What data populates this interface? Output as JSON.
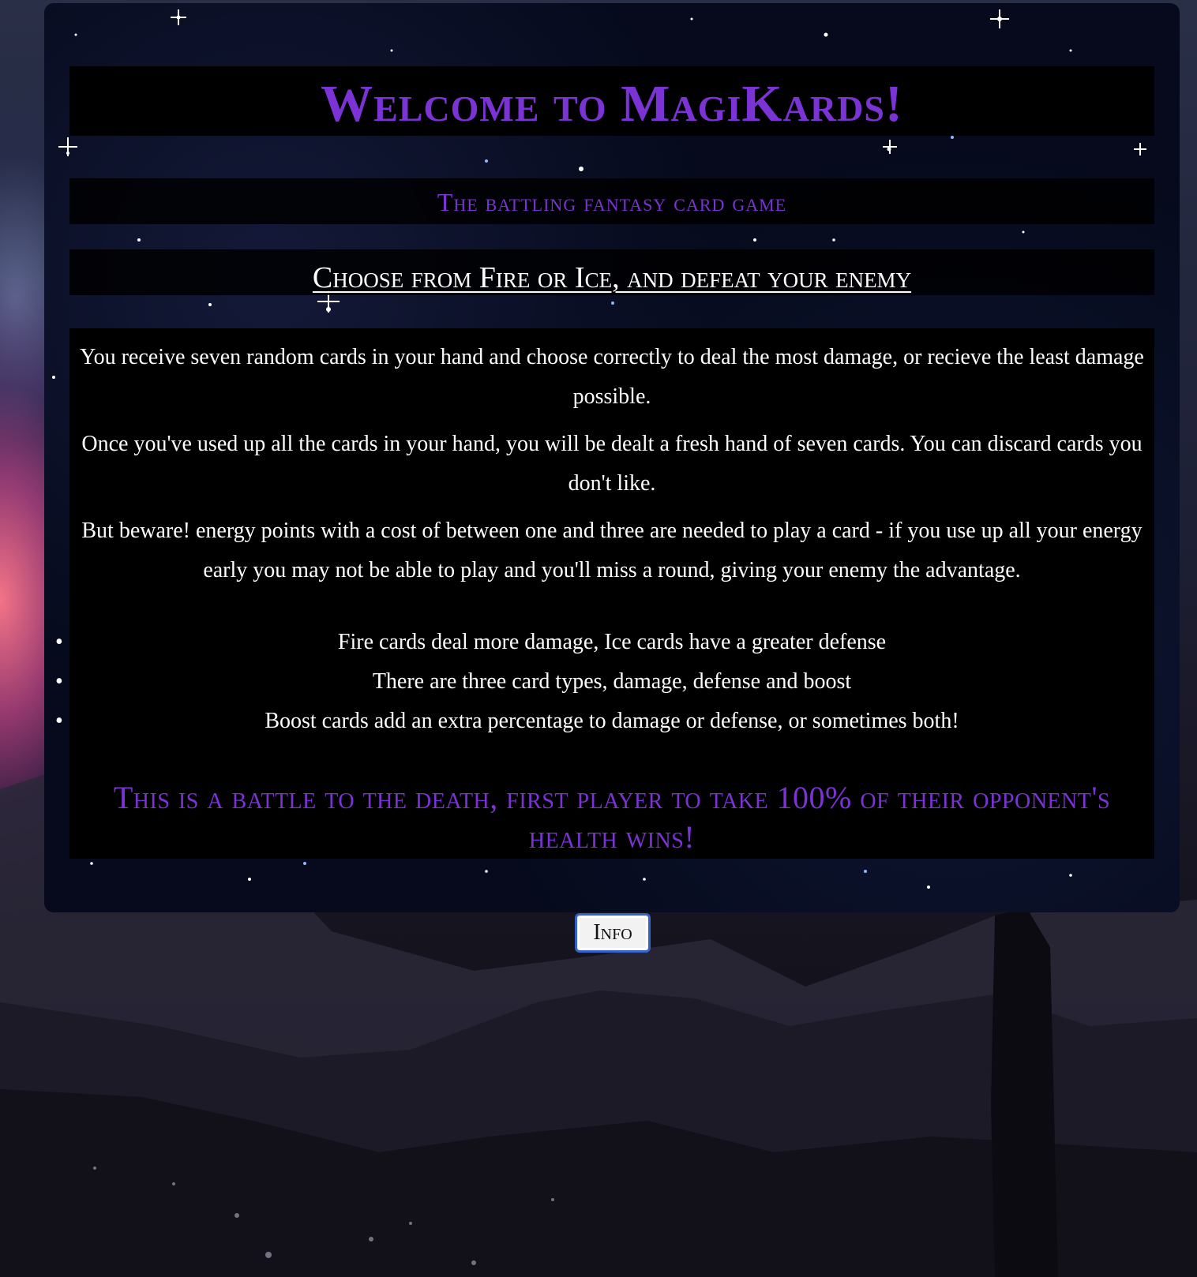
{
  "header": {
    "title": "Welcome to MagiKards!",
    "subtitle": "The battling fantasy card game",
    "tagline": "Choose from Fire or Ice, and defeat your enemy"
  },
  "content": {
    "paragraphs": [
      "You receive seven random cards in your hand and choose correctly to deal the most damage, or recieve the least damage possible.",
      "Once you've used up all the cards in your hand, you will be dealt a fresh hand of seven cards. You can discard cards you don't like.",
      "But beware! energy points with a cost of between one and three are needed to play a card - if you use up all your energy early you may not be able to play and you'll miss a round, giving your enemy the advantage."
    ],
    "rules": [
      "Fire cards deal more damage, Ice cards have a greater defense",
      "There are three card types, damage, defense and boost",
      "Boost cards add an extra percentage to damage or defense, or sometimes both!"
    ],
    "bullet": "•",
    "battle_note": "This is a battle to the death, first player to take 100% of their opponent's health wins!"
  },
  "actions": {
    "info_label": "Info"
  },
  "colors": {
    "accent_purple": "#7b33d6",
    "button_border": "#3563c9",
    "text_white": "#ffffff"
  }
}
